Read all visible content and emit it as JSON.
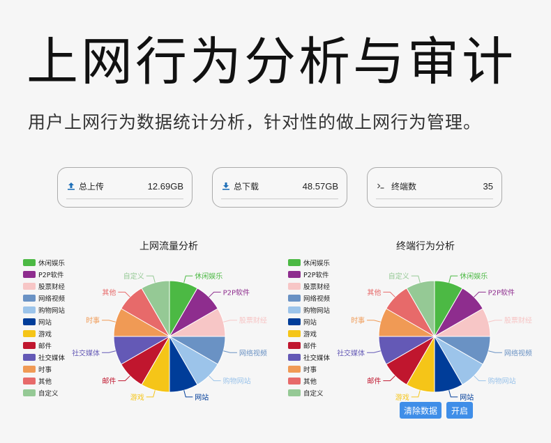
{
  "header": {
    "title": "上网行为分析与审计",
    "subtitle": "用户上网行为数据统计分析，针对性的做上网行为管理。"
  },
  "stats": {
    "upload": {
      "label": "总上传",
      "value": "12.69GB",
      "icon": "upload-icon"
    },
    "download": {
      "label": "总下载",
      "value": "48.57GB",
      "icon": "download-icon"
    },
    "terminals": {
      "label": "终端数",
      "value": "35",
      "icon": "terminal-icon"
    }
  },
  "buttons": {
    "clear": "清除数据",
    "enable": "开启"
  },
  "chart_data": [
    {
      "type": "pie",
      "title": "上网流量分析",
      "categories": [
        "休闲娱乐",
        "P2P软件",
        "股票财经",
        "网络视频",
        "购物网站",
        "网站",
        "游戏",
        "邮件",
        "社交媒体",
        "时事",
        "其他",
        "自定义"
      ],
      "values": [
        1,
        1,
        1,
        1,
        1,
        1,
        1,
        1,
        1,
        1,
        1,
        1
      ],
      "colors": [
        "#4cb944",
        "#8e2d8e",
        "#f7c6c6",
        "#6a92c4",
        "#9cc4ea",
        "#003d99",
        "#f5c518",
        "#c0162e",
        "#6459b6",
        "#f09a55",
        "#e76a6a",
        "#95c995"
      ],
      "legend": "left"
    },
    {
      "type": "pie",
      "title": "终端行为分析",
      "categories": [
        "休闲娱乐",
        "P2P软件",
        "股票财经",
        "网络视频",
        "购物网站",
        "网站",
        "游戏",
        "邮件",
        "社交媒体",
        "时事",
        "其他",
        "自定义"
      ],
      "values": [
        1,
        1,
        1,
        1,
        1,
        1,
        1,
        1,
        1,
        1,
        1,
        1
      ],
      "colors": [
        "#4cb944",
        "#8e2d8e",
        "#f7c6c6",
        "#6a92c4",
        "#9cc4ea",
        "#003d99",
        "#f5c518",
        "#c0162e",
        "#6459b6",
        "#f09a55",
        "#e76a6a",
        "#95c995"
      ],
      "legend": "left"
    }
  ]
}
